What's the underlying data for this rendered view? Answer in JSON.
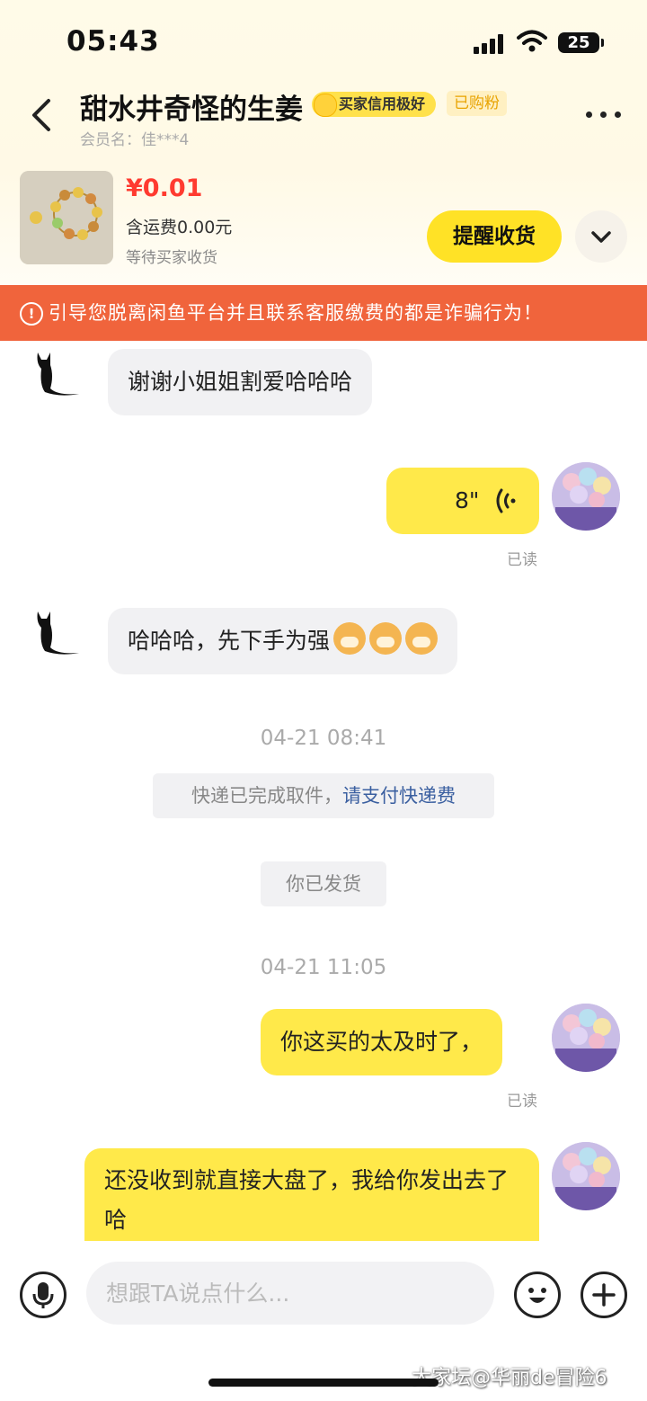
{
  "status_bar": {
    "time": "05:43",
    "battery": "25"
  },
  "header": {
    "title": "甜水井奇怪的生姜",
    "credit_badge": "买家信用极好",
    "bought_badge": "已购粉",
    "member_name": "会员名：佳***4",
    "icons": [
      "back-arrow-icon",
      "more-dots-icon"
    ]
  },
  "product": {
    "price": "¥0.01",
    "shipping": "含运费0.00元",
    "status": "等待买家收货",
    "remind_button": "提醒收货"
  },
  "warning": {
    "text": "引导您脱离闲鱼平台并且联系客服缴费的都是诈骗行为！"
  },
  "messages": {
    "m1": "谢谢小姐姐割爱哈哈哈",
    "voice_duration": "8\"",
    "read1": "已读",
    "m2": "哈哈哈，先下手为强",
    "time1": "04-21 08:41",
    "sys1_text": "快递已完成取件，",
    "sys1_link": "请支付快递费",
    "sys2": "你已发货",
    "time2": "04-21 11:05",
    "m3": "你这买的太及时了，",
    "read2": "已读",
    "m4": "还没收到就直接大盘了，我给你发出去了哈"
  },
  "input": {
    "placeholder": "想跟TA说点什么..."
  },
  "watermark": "大家坛@华丽de冒险6",
  "colors": {
    "accent_yellow": "#ffe226",
    "warning_bg": "#f0643c",
    "price_red": "#ff3b30",
    "link_blue": "#3a5fa0"
  }
}
